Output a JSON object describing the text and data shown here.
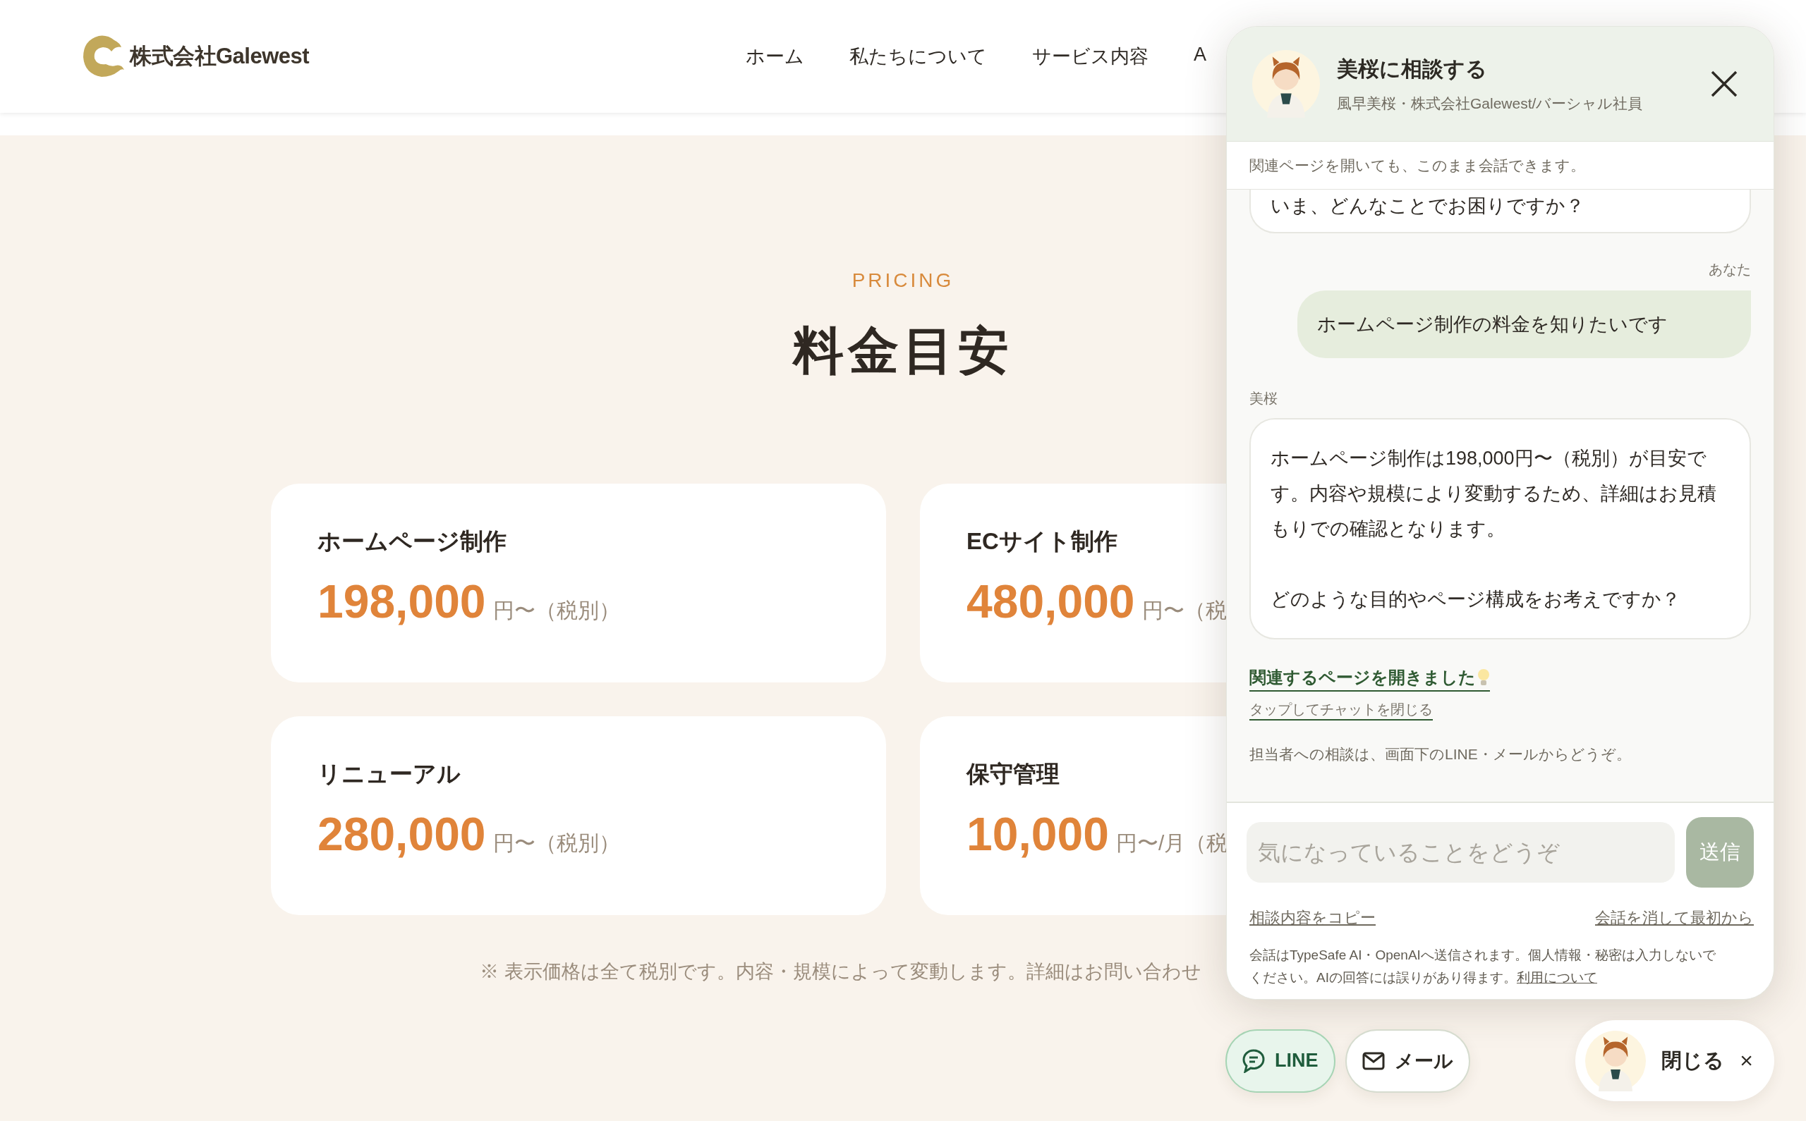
{
  "header": {
    "logo": "株式会社Galewest",
    "nav": [
      {
        "label": "ホーム"
      },
      {
        "label": "私たちについて"
      },
      {
        "label": "サービス内容"
      },
      {
        "label": "A"
      }
    ]
  },
  "pricing": {
    "eyebrow": "PRICING",
    "title": "料金目安",
    "plans": [
      {
        "name": "ホームページ制作",
        "price": "198,000",
        "unit": "円〜（税別）"
      },
      {
        "name": "ECサイト制作",
        "price": "480,000",
        "unit": "円〜（税"
      },
      {
        "name": "リニューアル",
        "price": "280,000",
        "unit": "円〜（税別）"
      },
      {
        "name": "保守管理",
        "price": "10,000",
        "unit": "円〜/月（税"
      }
    ],
    "note": "※ 表示価格は全て税別です。内容・規模によって変動します。詳細はお問い合わせ"
  },
  "chat": {
    "title": "美桜に相談する",
    "subtitle": "風早美桜・株式会社Galewest/バーシャル社員",
    "notice": "関連ページを開いても、このまま会話できます。",
    "messages": [
      {
        "kind": "bot",
        "paragraphs": [
          "いま、どんなことでお困りですか？"
        ]
      },
      {
        "kind": "user",
        "label": "あなた",
        "paragraphs": [
          "ホームページ制作の料金を知りたいです"
        ]
      },
      {
        "kind": "bot",
        "label": "美桜",
        "paragraphs": [
          "ホームページ制作は198,000円〜（税別）が目安です。内容や規模により変動するため、詳細はお見積もりでの確認となります。",
          "どのような目的やページ構成をお考えですか？"
        ]
      }
    ],
    "related_link": "関連するページを開きました",
    "close_hint": "タップしてチャットを閉じる",
    "contact_note": "担当者への相談は、画面下のLINE・メールからどうぞ。",
    "input": {
      "placeholder": "気になっていることをどうぞ"
    },
    "send_button": {
      "label": "送信",
      "disabled": true
    },
    "copy_link": "相談内容をコピー",
    "reset_link": "会話を消して最初から",
    "disclaimer": "会話はTypeSafe AI・OpenAIへ送信されます。個人情報・秘密は入力しないでください。AIの回答には誤りがあり得ます。",
    "terms_link": "利用について"
  },
  "actions": {
    "line": "LINE",
    "mail": "メール",
    "close": "閉じる",
    "close_icon": "×"
  }
}
